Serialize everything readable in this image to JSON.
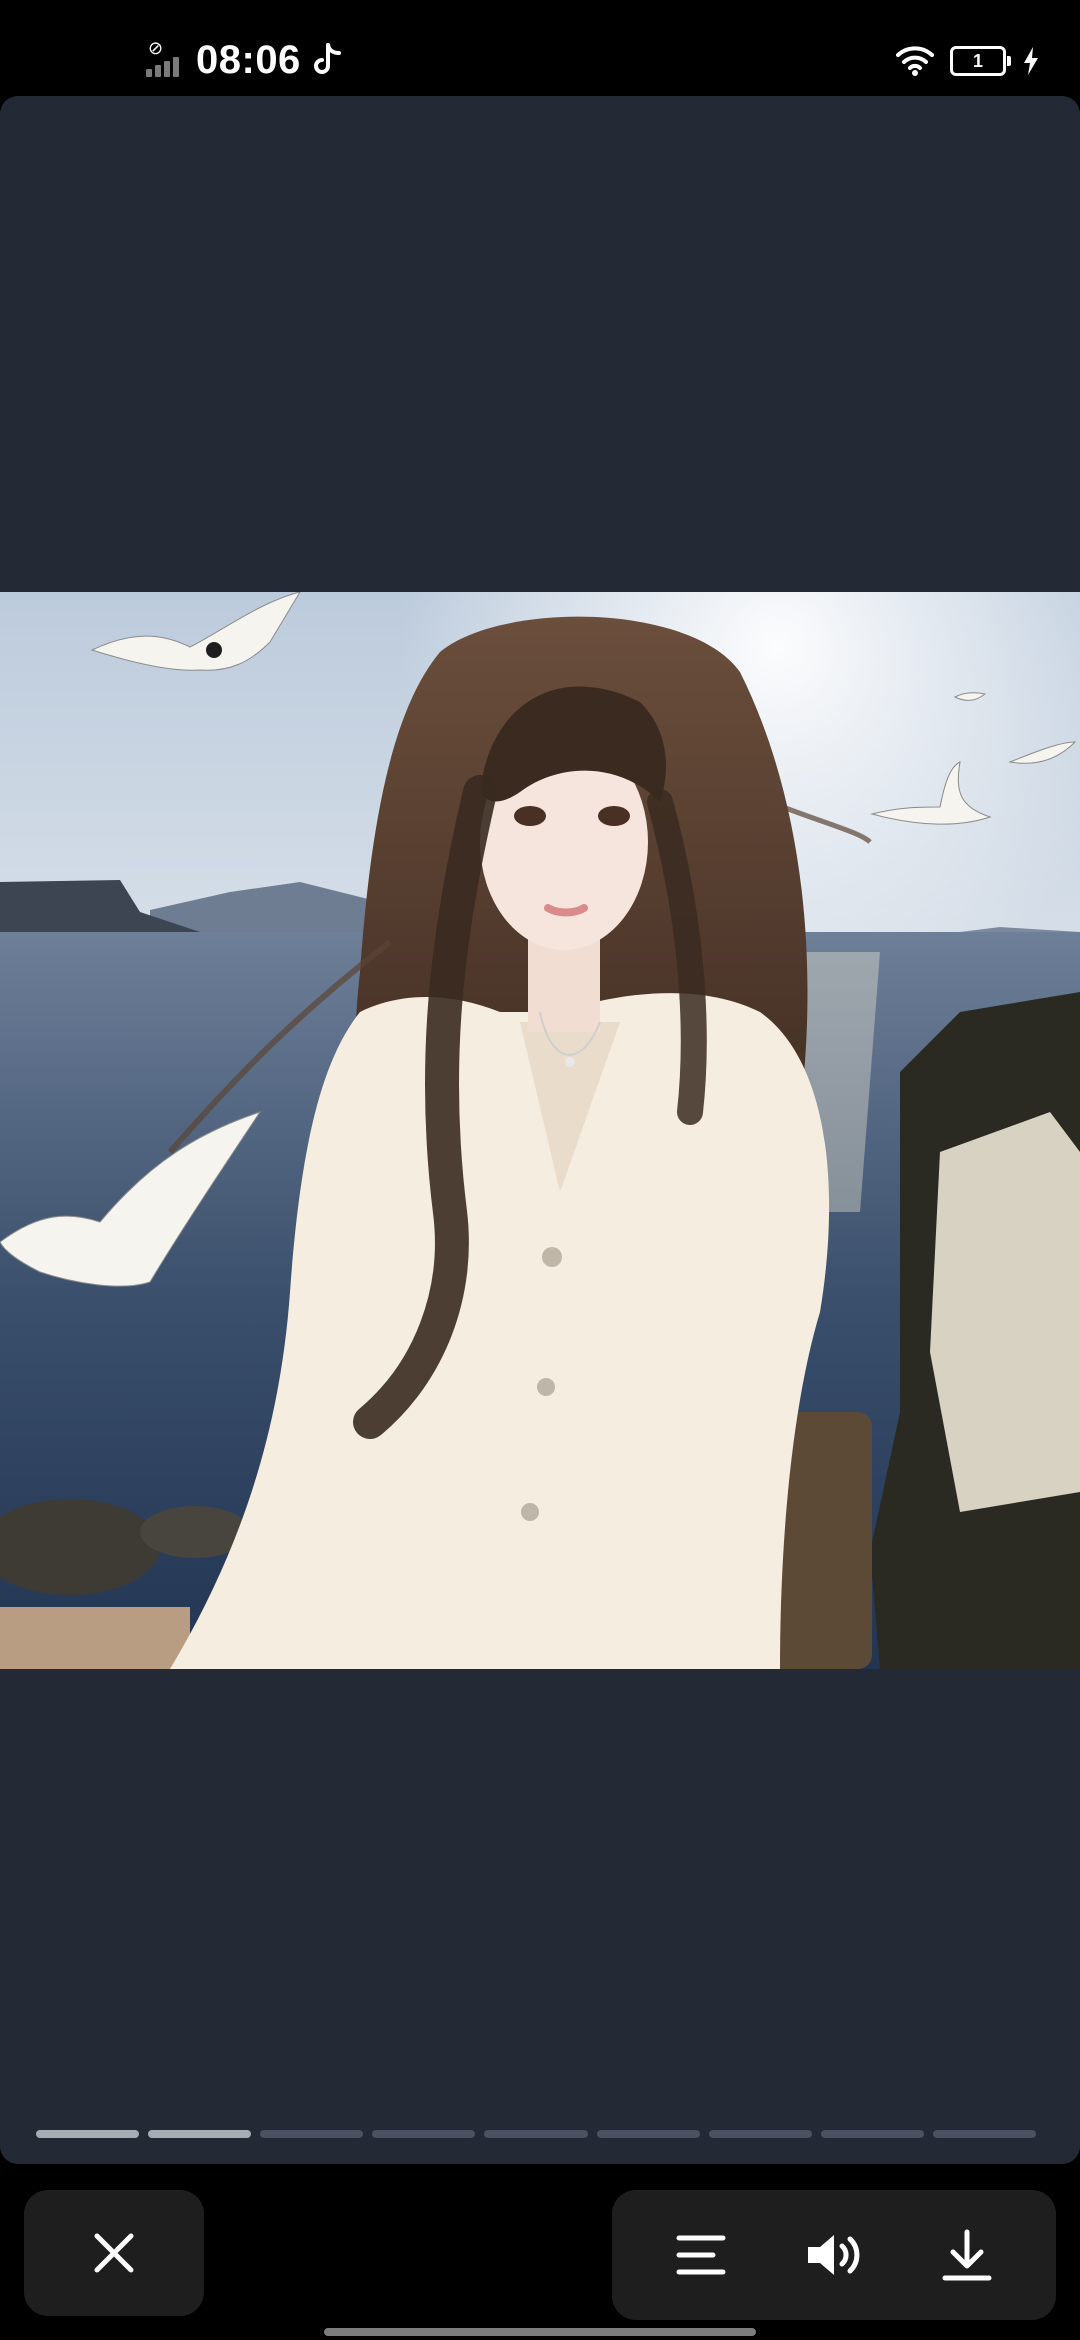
{
  "status_bar": {
    "time": "08:06",
    "battery_level": "1",
    "icons": [
      "no-sim-signal-icon",
      "tiktok-icon",
      "wifi-icon",
      "battery-icon",
      "charging-icon"
    ]
  },
  "viewer": {
    "background": "#242a35",
    "image_description_icon": "photo",
    "progress": {
      "total": 9,
      "current": 2
    }
  },
  "bottom_bar": {
    "icons": [
      "close-icon",
      "menu-icon",
      "volume-icon",
      "download-icon"
    ]
  }
}
